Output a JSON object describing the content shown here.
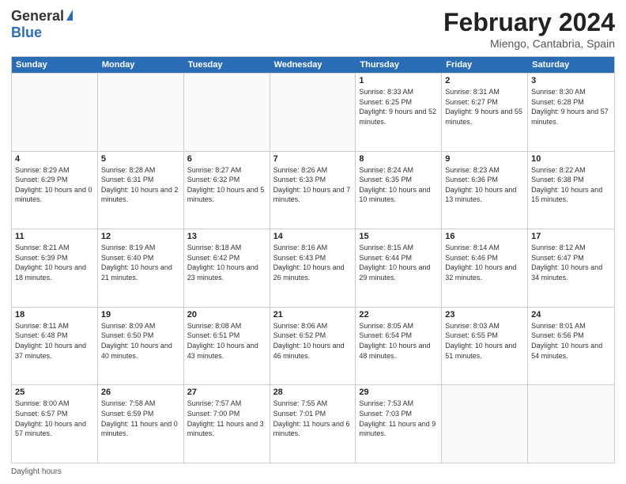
{
  "logo": {
    "general": "General",
    "blue": "Blue"
  },
  "title": "February 2024",
  "subtitle": "Miengo, Cantabria, Spain",
  "days_of_week": [
    "Sunday",
    "Monday",
    "Tuesday",
    "Wednesday",
    "Thursday",
    "Friday",
    "Saturday"
  ],
  "weeks": [
    [
      {
        "day": "",
        "info": ""
      },
      {
        "day": "",
        "info": ""
      },
      {
        "day": "",
        "info": ""
      },
      {
        "day": "",
        "info": ""
      },
      {
        "day": "1",
        "info": "Sunrise: 8:33 AM\nSunset: 6:25 PM\nDaylight: 9 hours and 52 minutes."
      },
      {
        "day": "2",
        "info": "Sunrise: 8:31 AM\nSunset: 6:27 PM\nDaylight: 9 hours and 55 minutes."
      },
      {
        "day": "3",
        "info": "Sunrise: 8:30 AM\nSunset: 6:28 PM\nDaylight: 9 hours and 57 minutes."
      }
    ],
    [
      {
        "day": "4",
        "info": "Sunrise: 8:29 AM\nSunset: 6:29 PM\nDaylight: 10 hours and 0 minutes."
      },
      {
        "day": "5",
        "info": "Sunrise: 8:28 AM\nSunset: 6:31 PM\nDaylight: 10 hours and 2 minutes."
      },
      {
        "day": "6",
        "info": "Sunrise: 8:27 AM\nSunset: 6:32 PM\nDaylight: 10 hours and 5 minutes."
      },
      {
        "day": "7",
        "info": "Sunrise: 8:26 AM\nSunset: 6:33 PM\nDaylight: 10 hours and 7 minutes."
      },
      {
        "day": "8",
        "info": "Sunrise: 8:24 AM\nSunset: 6:35 PM\nDaylight: 10 hours and 10 minutes."
      },
      {
        "day": "9",
        "info": "Sunrise: 8:23 AM\nSunset: 6:36 PM\nDaylight: 10 hours and 13 minutes."
      },
      {
        "day": "10",
        "info": "Sunrise: 8:22 AM\nSunset: 6:38 PM\nDaylight: 10 hours and 15 minutes."
      }
    ],
    [
      {
        "day": "11",
        "info": "Sunrise: 8:21 AM\nSunset: 6:39 PM\nDaylight: 10 hours and 18 minutes."
      },
      {
        "day": "12",
        "info": "Sunrise: 8:19 AM\nSunset: 6:40 PM\nDaylight: 10 hours and 21 minutes."
      },
      {
        "day": "13",
        "info": "Sunrise: 8:18 AM\nSunset: 6:42 PM\nDaylight: 10 hours and 23 minutes."
      },
      {
        "day": "14",
        "info": "Sunrise: 8:16 AM\nSunset: 6:43 PM\nDaylight: 10 hours and 26 minutes."
      },
      {
        "day": "15",
        "info": "Sunrise: 8:15 AM\nSunset: 6:44 PM\nDaylight: 10 hours and 29 minutes."
      },
      {
        "day": "16",
        "info": "Sunrise: 8:14 AM\nSunset: 6:46 PM\nDaylight: 10 hours and 32 minutes."
      },
      {
        "day": "17",
        "info": "Sunrise: 8:12 AM\nSunset: 6:47 PM\nDaylight: 10 hours and 34 minutes."
      }
    ],
    [
      {
        "day": "18",
        "info": "Sunrise: 8:11 AM\nSunset: 6:48 PM\nDaylight: 10 hours and 37 minutes."
      },
      {
        "day": "19",
        "info": "Sunrise: 8:09 AM\nSunset: 6:50 PM\nDaylight: 10 hours and 40 minutes."
      },
      {
        "day": "20",
        "info": "Sunrise: 8:08 AM\nSunset: 6:51 PM\nDaylight: 10 hours and 43 minutes."
      },
      {
        "day": "21",
        "info": "Sunrise: 8:06 AM\nSunset: 6:52 PM\nDaylight: 10 hours and 46 minutes."
      },
      {
        "day": "22",
        "info": "Sunrise: 8:05 AM\nSunset: 6:54 PM\nDaylight: 10 hours and 48 minutes."
      },
      {
        "day": "23",
        "info": "Sunrise: 8:03 AM\nSunset: 6:55 PM\nDaylight: 10 hours and 51 minutes."
      },
      {
        "day": "24",
        "info": "Sunrise: 8:01 AM\nSunset: 6:56 PM\nDaylight: 10 hours and 54 minutes."
      }
    ],
    [
      {
        "day": "25",
        "info": "Sunrise: 8:00 AM\nSunset: 6:57 PM\nDaylight: 10 hours and 57 minutes."
      },
      {
        "day": "26",
        "info": "Sunrise: 7:58 AM\nSunset: 6:59 PM\nDaylight: 11 hours and 0 minutes."
      },
      {
        "day": "27",
        "info": "Sunrise: 7:57 AM\nSunset: 7:00 PM\nDaylight: 11 hours and 3 minutes."
      },
      {
        "day": "28",
        "info": "Sunrise: 7:55 AM\nSunset: 7:01 PM\nDaylight: 11 hours and 6 minutes."
      },
      {
        "day": "29",
        "info": "Sunrise: 7:53 AM\nSunset: 7:03 PM\nDaylight: 11 hours and 9 minutes."
      },
      {
        "day": "",
        "info": ""
      },
      {
        "day": "",
        "info": ""
      }
    ]
  ],
  "footer": {
    "daylight_label": "Daylight hours"
  }
}
